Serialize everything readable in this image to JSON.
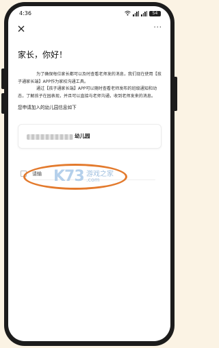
{
  "status_bar": {
    "time": "4:36",
    "battery": "54"
  },
  "nav": {
    "close_glyph": "✕",
    "more_glyph": "···"
  },
  "letter": {
    "greeting": "家长，你好！",
    "paragraph_1": "为了确保每位家长都可以及时查看老师发的消息，我们现在使用【孩子通家长端】APP作为家校沟通工具。",
    "paragraph_2": "通过【孩子通家长端】APP可以随时查看老师发布的班级通知和动态，了解孩子在园表现，并且可以直接与老师沟通，收到老师发来的消息。",
    "section_label": "您申请加入的幼儿园信息如下"
  },
  "school": {
    "name_suffix": "幼儿园"
  },
  "input": {
    "label": "请输"
  },
  "watermark": {
    "logo": "K73",
    "site": "游戏之家",
    "domain": ".com"
  },
  "colors": {
    "accent_orange": "#e37a2d",
    "watermark_blue": "#a8c8e8",
    "page_bg": "#fbf3e4"
  },
  "icons": {
    "close": "close-icon",
    "more": "more-icon",
    "wifi": "wifi-icon",
    "signal": "signal-icon",
    "battery": "battery-icon"
  }
}
